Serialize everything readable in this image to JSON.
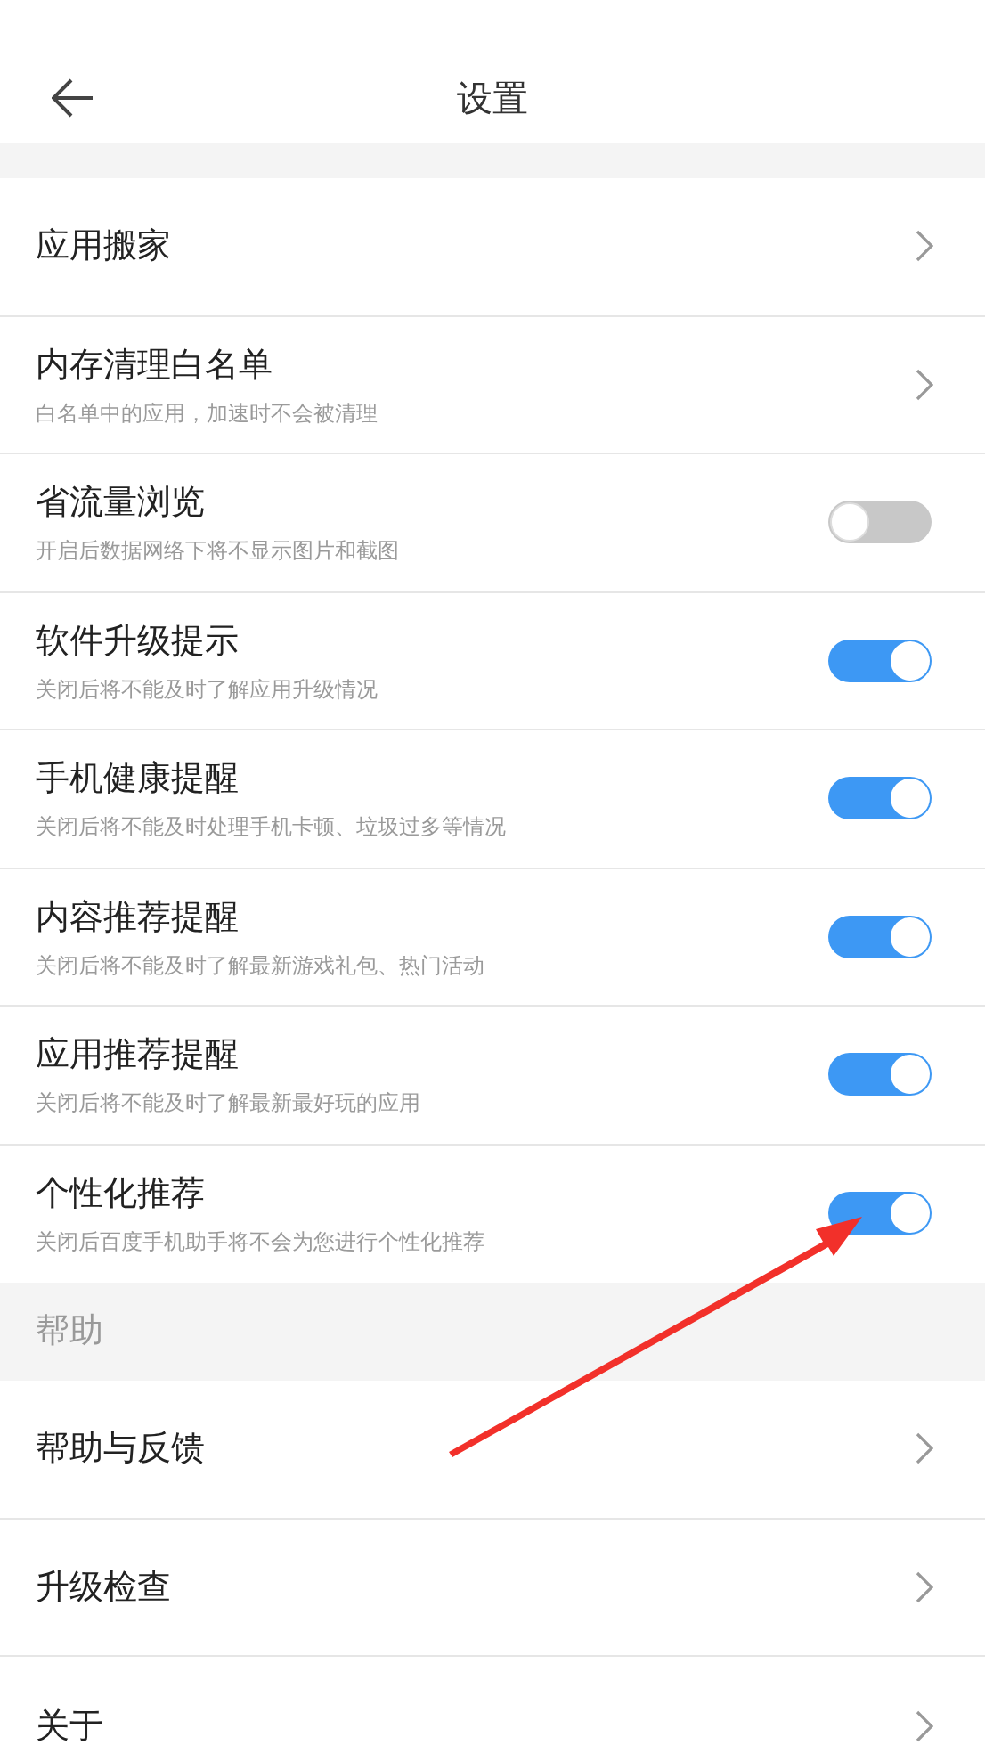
{
  "title": "设置",
  "sections": [
    {
      "items": [
        {
          "kind": "link",
          "label": "应用搬家"
        },
        {
          "kind": "link",
          "label": "内存清理白名单",
          "description": "白名单中的应用，加速时不会被清理"
        },
        {
          "kind": "toggle",
          "label": "省流量浏览",
          "description": "开启后数据网络下将不显示图片和截图",
          "on": false
        },
        {
          "kind": "toggle",
          "label": "软件升级提示",
          "description": "关闭后将不能及时了解应用升级情况",
          "on": true
        },
        {
          "kind": "toggle",
          "label": "手机健康提醒",
          "description": "关闭后将不能及时处理手机卡顿、垃圾过多等情况",
          "on": true
        },
        {
          "kind": "toggle",
          "label": "内容推荐提醒",
          "description": "关闭后将不能及时了解最新游戏礼包、热门活动",
          "on": true
        },
        {
          "kind": "toggle",
          "label": "应用推荐提醒",
          "description": "关闭后将不能及时了解最新最好玩的应用",
          "on": true
        },
        {
          "kind": "toggle",
          "label": "个性化推荐",
          "description": "关闭后百度手机助手将不会为您进行个性化推荐",
          "on": true
        }
      ]
    },
    {
      "header": "帮助",
      "items": [
        {
          "kind": "link",
          "label": "帮助与反馈"
        },
        {
          "kind": "link",
          "label": "升级检查"
        },
        {
          "kind": "link",
          "label": "关于"
        }
      ]
    }
  ]
}
